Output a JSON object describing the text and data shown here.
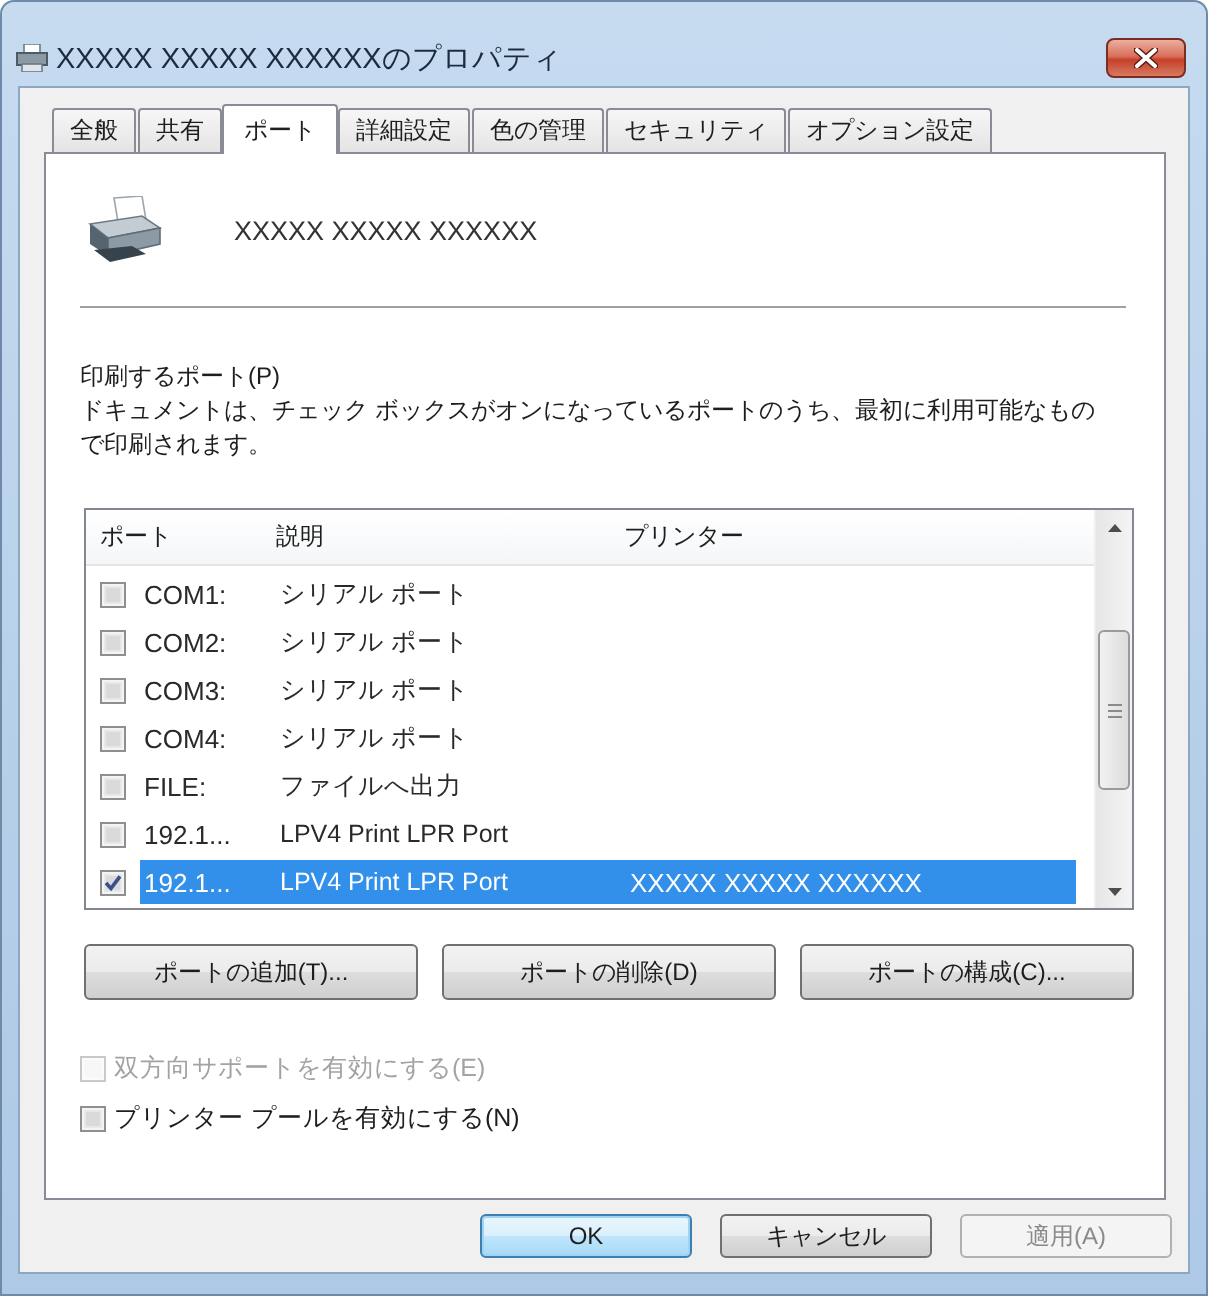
{
  "window": {
    "title": "XXXXX XXXXX XXXXXXのプロパティ"
  },
  "tabs": [
    {
      "label": "全般",
      "selected": false
    },
    {
      "label": "共有",
      "selected": false
    },
    {
      "label": "ポート",
      "selected": true
    },
    {
      "label": "詳細設定",
      "selected": false
    },
    {
      "label": "色の管理",
      "selected": false
    },
    {
      "label": "セキュリティ",
      "selected": false
    },
    {
      "label": "オプション設定",
      "selected": false
    }
  ],
  "printer": {
    "name": "XXXXX XXXXX XXXXXX"
  },
  "ports_section": {
    "label": "印刷するポート(P)",
    "description": "ドキュメントは、チェック ボックスがオンになっているポートのうち、最初に利用可能なもので印刷されます。"
  },
  "ports_table": {
    "columns": [
      "ポート",
      "説明",
      "プリンター"
    ],
    "rows": [
      {
        "checked": false,
        "selected": false,
        "port": "COM1:",
        "description": "シリアル ポート"
      },
      {
        "checked": false,
        "selected": false,
        "port": "COM2:",
        "description": "シリアル ポート"
      },
      {
        "checked": false,
        "selected": false,
        "port": "COM3:",
        "description": "シリアル ポート"
      },
      {
        "checked": false,
        "selected": false,
        "port": "COM4:",
        "description": "シリアル ポート"
      },
      {
        "checked": false,
        "selected": false,
        "port": "FILE:",
        "description": "ファイルへ出力"
      },
      {
        "checked": false,
        "selected": false,
        "port": "192.1...",
        "description": "LPV4 Print LPR Port"
      },
      {
        "checked": true,
        "selected": true,
        "port": "192.1...",
        "description": "LPV4 Print LPR Port",
        "printer": "XXXXX XXXXX XXXXXX"
      }
    ]
  },
  "port_buttons": [
    "ポートの追加(T)...",
    "ポートの削除(D)",
    "ポートの構成(C)..."
  ],
  "options": [
    {
      "label": "双方向サポートを有効にする(E)",
      "checked": false,
      "disabled": true
    },
    {
      "label": "プリンター プールを有効にする(N)",
      "checked": false,
      "disabled": false
    }
  ],
  "dialog_buttons": [
    {
      "label": "OK",
      "default": true,
      "disabled": false
    },
    {
      "label": "キャンセル",
      "default": false,
      "disabled": false
    },
    {
      "label": "適用(A)",
      "default": false,
      "disabled": true
    }
  ]
}
